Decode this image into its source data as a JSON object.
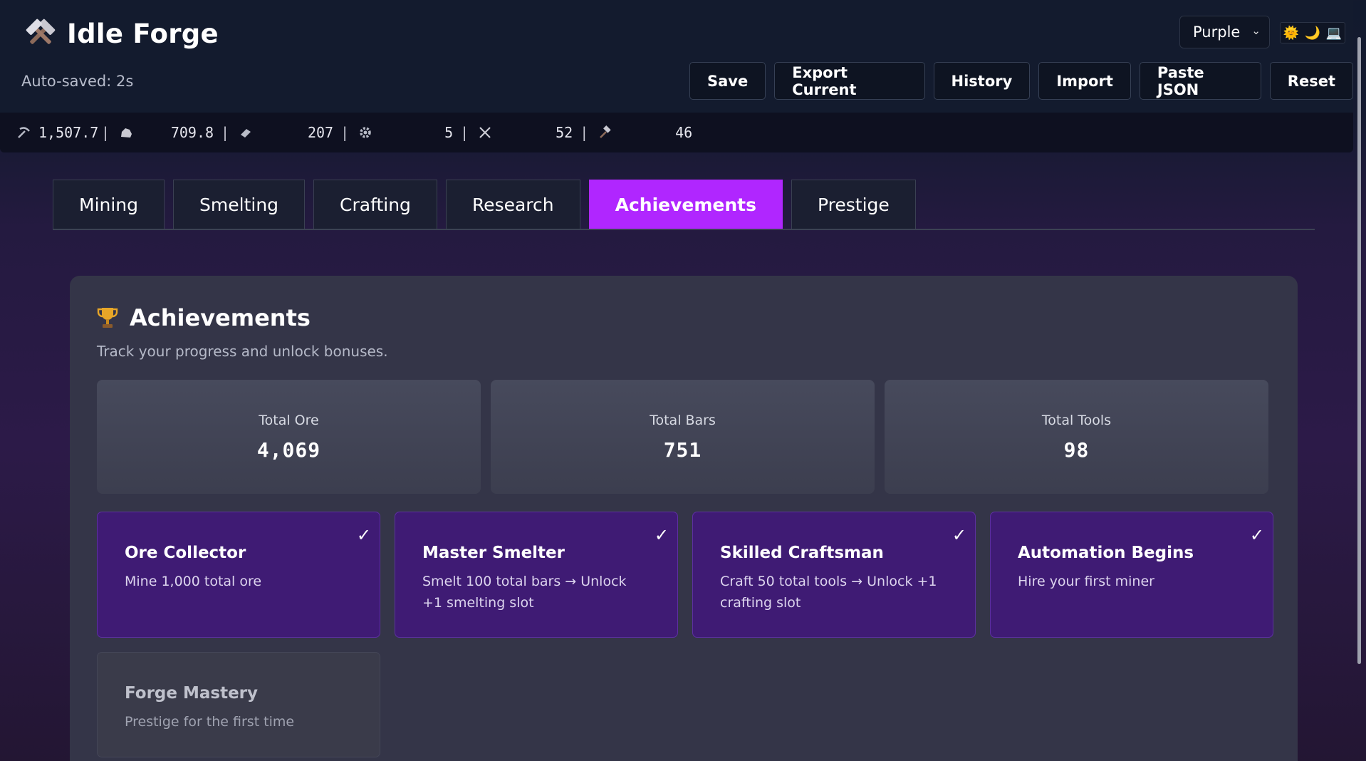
{
  "app": {
    "title": "Idle Forge",
    "logo_icon": "crossed-hammers-icon",
    "autosave": "Auto-saved: 2s"
  },
  "theme": {
    "selected": "Purple",
    "modes": [
      {
        "name": "light-mode-icon",
        "glyph": "🌞"
      },
      {
        "name": "dark-mode-icon",
        "glyph": "🌙"
      },
      {
        "name": "system-mode-icon",
        "glyph": "💻"
      }
    ]
  },
  "actions": [
    "Save",
    "Export Current",
    "History",
    "Import",
    "Paste JSON",
    "Reset"
  ],
  "resources": [
    {
      "icon": "pickaxe-icon",
      "value": "1,507.7"
    },
    {
      "icon": "ore-rock-icon",
      "value": "709.8"
    },
    {
      "icon": "bar-icon",
      "value": "207"
    },
    {
      "icon": "gear-icon",
      "value": "5"
    },
    {
      "icon": "crossed-swords-icon",
      "value": "52"
    },
    {
      "icon": "hammer-icon",
      "value": "46"
    }
  ],
  "tabs": [
    {
      "label": "Mining",
      "active": false
    },
    {
      "label": "Smelting",
      "active": false
    },
    {
      "label": "Crafting",
      "active": false
    },
    {
      "label": "Research",
      "active": false
    },
    {
      "label": "Achievements",
      "active": true
    },
    {
      "label": "Prestige",
      "active": false
    }
  ],
  "panel": {
    "title": "Achievements",
    "icon": "trophy-icon",
    "subtitle": "Track your progress and unlock bonuses."
  },
  "stats": [
    {
      "label": "Total Ore",
      "value": "4,069"
    },
    {
      "label": "Total Bars",
      "value": "751"
    },
    {
      "label": "Total Tools",
      "value": "98"
    }
  ],
  "achievements": [
    {
      "name": "Ore Collector",
      "desc": "Mine 1,000 total ore",
      "unlocked": true
    },
    {
      "name": "Master Smelter",
      "desc": "Smelt 100 total bars → Unlock +1 smelting slot",
      "unlocked": true
    },
    {
      "name": "Skilled Craftsman",
      "desc": "Craft 50 total tools → Unlock +1 crafting slot",
      "unlocked": true
    },
    {
      "name": "Automation Begins",
      "desc": "Hire your first miner",
      "unlocked": true
    },
    {
      "name": "Forge Mastery",
      "desc": "Prestige for the first time",
      "unlocked": false
    }
  ],
  "check_glyph": "✓",
  "colors": {
    "accent": "#b026ff",
    "unlocked_card": "#3f1b74",
    "locked_card": "#3a3b4a",
    "header_bg": "#131b2e"
  }
}
